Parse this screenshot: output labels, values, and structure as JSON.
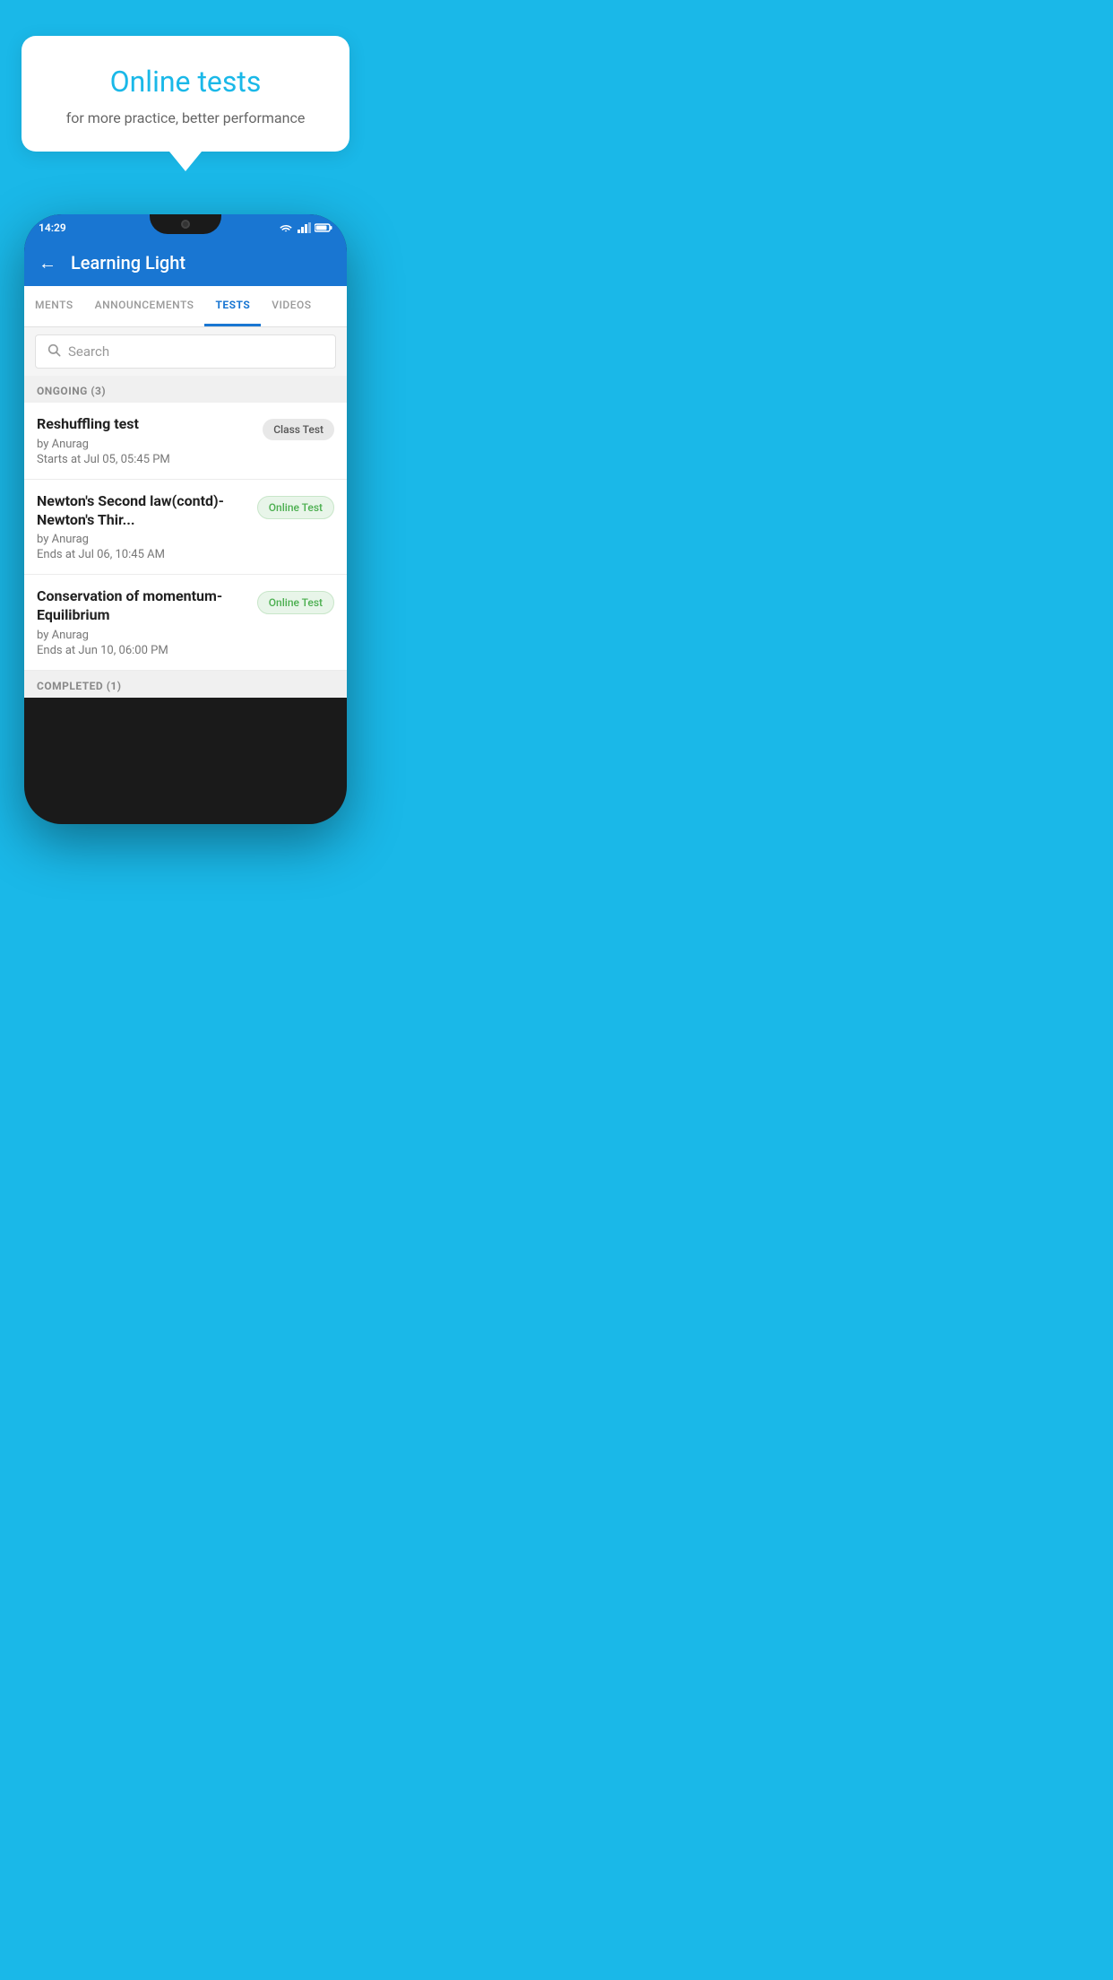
{
  "background_color": "#1ab8e8",
  "speech_bubble": {
    "title": "Online tests",
    "subtitle": "for more practice, better performance"
  },
  "phone": {
    "status_bar": {
      "time": "14:29",
      "icons": [
        "wifi",
        "signal",
        "battery"
      ]
    },
    "app_bar": {
      "back_label": "←",
      "title": "Learning Light"
    },
    "tabs": [
      {
        "label": "MENTS",
        "active": false
      },
      {
        "label": "ANNOUNCEMENTS",
        "active": false
      },
      {
        "label": "TESTS",
        "active": true
      },
      {
        "label": "VIDEOS",
        "active": false
      }
    ],
    "search": {
      "placeholder": "Search"
    },
    "ongoing_section": {
      "header": "ONGOING (3)",
      "items": [
        {
          "title": "Reshuffling test",
          "author": "by Anurag",
          "time": "Starts at  Jul 05, 05:45 PM",
          "badge": "Class Test",
          "badge_type": "class"
        },
        {
          "title": "Newton's Second law(contd)-Newton's Thir...",
          "author": "by Anurag",
          "time": "Ends at  Jul 06, 10:45 AM",
          "badge": "Online Test",
          "badge_type": "online"
        },
        {
          "title": "Conservation of momentum-Equilibrium",
          "author": "by Anurag",
          "time": "Ends at  Jun 10, 06:00 PM",
          "badge": "Online Test",
          "badge_type": "online"
        }
      ]
    },
    "completed_section": {
      "header": "COMPLETED (1)"
    }
  }
}
